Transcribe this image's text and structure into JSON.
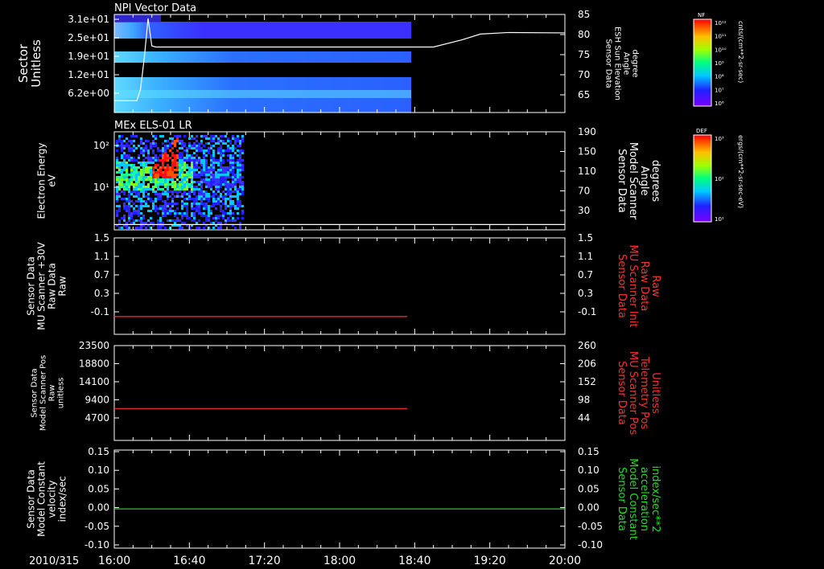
{
  "date_label": "2010/315",
  "x_ticks": [
    "16:00",
    "16:40",
    "17:20",
    "18:00",
    "18:40",
    "19:20",
    "20:00"
  ],
  "colorbars": [
    {
      "label": "NF",
      "unit": "cnts/(cm**2-sr-sec)",
      "ticks": [
        "10¹²",
        "10¹¹",
        "10¹⁰",
        "10⁹",
        "10⁸",
        "10⁷",
        "10⁶"
      ]
    },
    {
      "label": "DEF",
      "unit": "ergs/(cm**2-sr-sec-eV)",
      "ticks": [
        "10³",
        "10²",
        "10¹"
      ]
    }
  ],
  "chart_data": [
    {
      "type": "heatmap",
      "title": "NPI Vector Data",
      "ylabel": [
        "Sector",
        "Unitless"
      ],
      "y_ticks": [
        "3.1e+01",
        "2.5e+01",
        "1.9e+01",
        "1.2e+01",
        "6.2e+00"
      ],
      "y2label": [
        "Sensor Data",
        "ESH Sun Elevation",
        "Angle",
        "degree"
      ],
      "y2_ticks": [
        "85",
        "80",
        "75",
        "70",
        "65"
      ],
      "y2lim": [
        60,
        85
      ],
      "overlay_line": {
        "color": "#ffffff",
        "x": [
          "16:00",
          "16:12",
          "16:14",
          "16:16",
          "16:18",
          "16:20",
          "16:22",
          "18:50",
          "19:05",
          "19:15",
          "19:30",
          "20:00"
        ],
        "y": [
          63,
          63,
          66,
          74,
          84,
          77,
          76.7,
          76.7,
          78.5,
          80,
          80.4,
          80.3
        ]
      }
    },
    {
      "type": "heatmap",
      "title": "MEx ELS-01 LR",
      "ylabel": [
        "Electron Energy",
        "eV"
      ],
      "y_ticks": [
        "10²",
        "10¹"
      ],
      "y2label": [
        "Sensor Data",
        "Model Scanner",
        "Angle",
        "degrees"
      ],
      "y2_ticks": [
        "190",
        "150",
        "110",
        "70",
        "30"
      ],
      "y2lim": [
        5,
        190
      ],
      "overlay_line": {
        "color": "#ffffff",
        "x": [
          "16:00",
          "20:00"
        ],
        "y": [
          15,
          15
        ]
      }
    },
    {
      "type": "line",
      "ylabel": [
        "Sensor Data",
        "MU Scanner +30V",
        "Raw Data",
        "Raw"
      ],
      "y_ticks": [
        "1.5",
        "1.1",
        "0.7",
        "0.3",
        "-0.1"
      ],
      "ylim": [
        -0.4,
        1.5
      ],
      "y2label": [
        "Sensor Data",
        "MU Scanner Init",
        "Raw Data",
        "Raw"
      ],
      "y2_ticks": [
        "1.5",
        "1.1",
        "0.7",
        "0.3",
        "-0.1"
      ],
      "series": [
        {
          "color": "#ff3030",
          "x": [
            "16:00",
            "18:36"
          ],
          "y": [
            -0.05,
            -0.05
          ]
        }
      ]
    },
    {
      "type": "line",
      "ylabel": [
        "Sensor Data",
        "Model Scanner Pos",
        "Raw",
        "unitless"
      ],
      "y_ticks": [
        "23500",
        "18800",
        "14100",
        "9400",
        "4700"
      ],
      "ylim": [
        0,
        23500
      ],
      "y2label": [
        "Sensor Data",
        "MU Scanner Pos",
        "Telemetry Pos",
        "Unitless"
      ],
      "y2_ticks": [
        "260",
        "206",
        "152",
        "98",
        "44"
      ],
      "series": [
        {
          "color": "#ff3030",
          "x": [
            "16:00",
            "18:36"
          ],
          "y": [
            7900,
            7900
          ]
        }
      ]
    },
    {
      "type": "line",
      "ylabel": [
        "Sensor Data",
        "Model Constant",
        "velocity",
        "index/sec"
      ],
      "y_ticks": [
        "0.15",
        "0.10",
        "0.05",
        "0.00",
        "-0.05",
        "-0.10"
      ],
      "ylim": [
        -0.1,
        0.15
      ],
      "y2label": [
        "Sensor Data",
        "Model Constant",
        "acceleration",
        "index/sec**2"
      ],
      "y2_ticks": [
        "0.15",
        "0.10",
        "0.05",
        "0.00",
        "-0.05",
        "-0.10"
      ],
      "series": [
        {
          "color": "#20e020",
          "x": [
            "16:00",
            "20:00"
          ],
          "y": [
            0.0,
            0.0
          ]
        }
      ]
    }
  ]
}
